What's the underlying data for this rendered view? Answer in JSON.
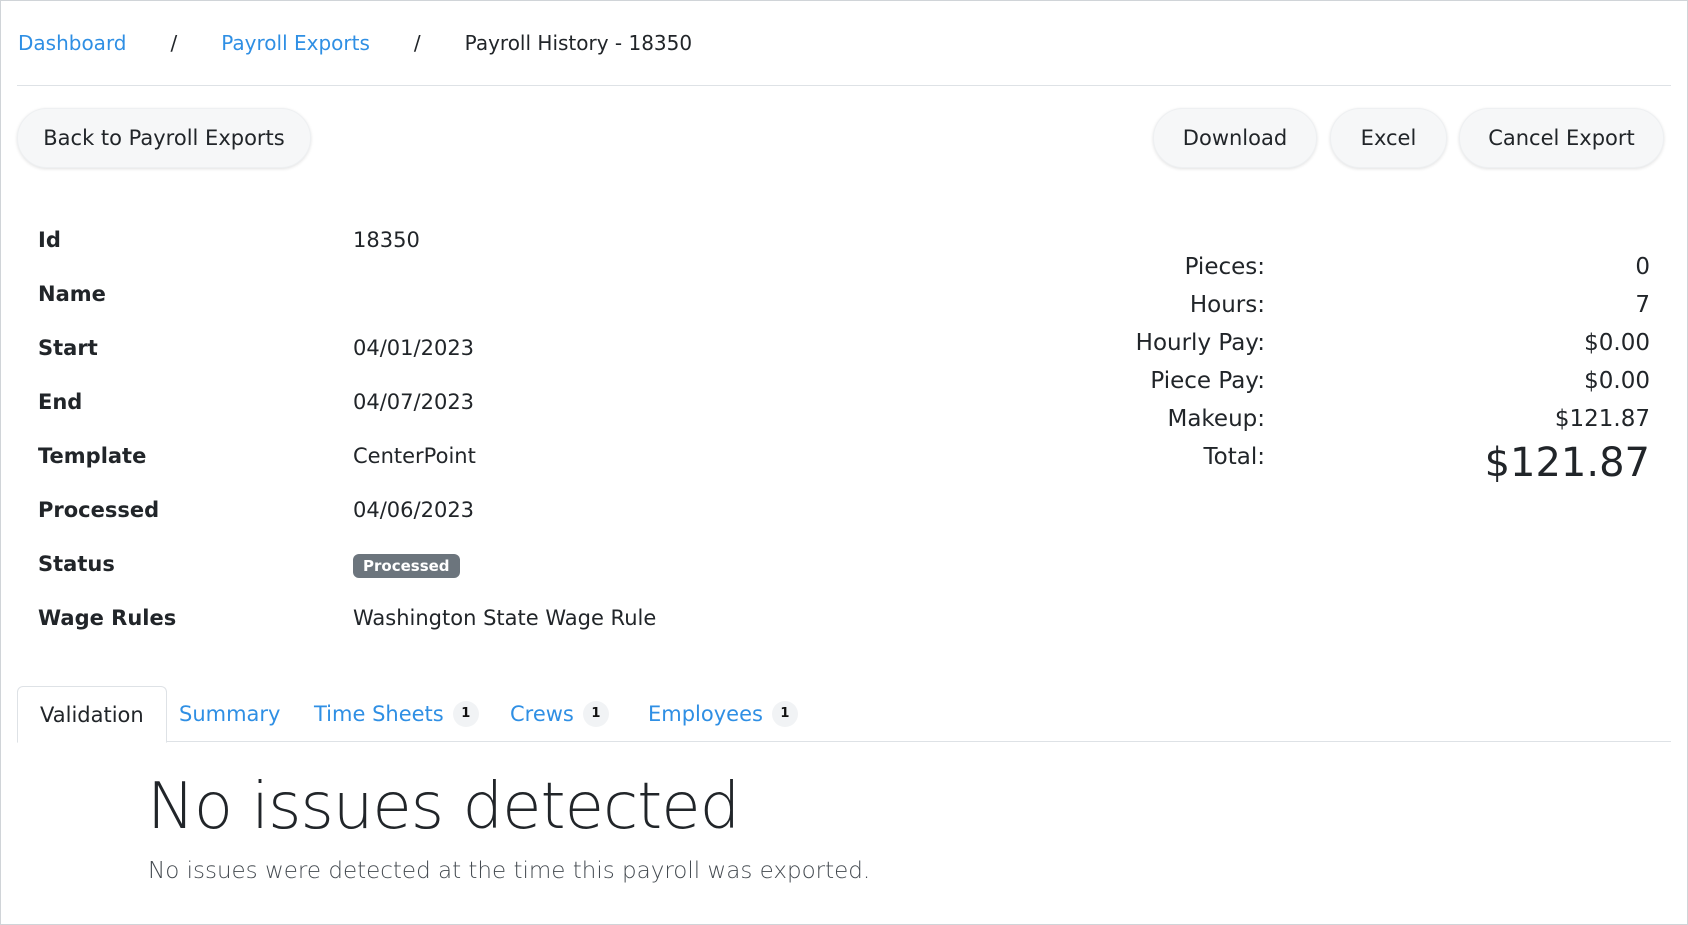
{
  "breadcrumb": {
    "dashboard": "Dashboard",
    "separator": "/",
    "payroll_exports": "Payroll Exports",
    "current": "Payroll History - 18350"
  },
  "actions": {
    "back": "Back to Payroll Exports",
    "download": "Download",
    "excel": "Excel",
    "cancel": "Cancel Export"
  },
  "details": {
    "id_label": "Id",
    "id_value": "18350",
    "name_label": "Name",
    "name_value": "",
    "start_label": "Start",
    "start_value": "04/01/2023",
    "end_label": "End",
    "end_value": "04/07/2023",
    "template_label": "Template",
    "template_value": "CenterPoint",
    "processed_label": "Processed",
    "processed_value": "04/06/2023",
    "status_label": "Status",
    "status_value": "Processed",
    "wage_rules_label": "Wage Rules",
    "wage_rules_value": "Washington State Wage Rule"
  },
  "totals": {
    "pieces_label": "Pieces:",
    "pieces_value": "0",
    "hours_label": "Hours:",
    "hours_value": "7",
    "hourly_pay_label": "Hourly Pay:",
    "hourly_pay_value": "$0.00",
    "piece_pay_label": "Piece Pay:",
    "piece_pay_value": "$0.00",
    "makeup_label": "Makeup:",
    "makeup_value": "$121.87",
    "total_label": "Total:",
    "total_value": "$121.87"
  },
  "tabs": {
    "validation": "Validation",
    "summary": "Summary",
    "time_sheets": "Time Sheets",
    "time_sheets_count": "1",
    "crews": "Crews",
    "crews_count": "1",
    "employees": "Employees",
    "employees_count": "1"
  },
  "validation_panel": {
    "title": "No issues detected",
    "message": "No issues were detected at the time this payroll was exported."
  },
  "colors": {
    "link": "#2f8fe4",
    "badge": "#6c757d",
    "text": "#212529"
  }
}
